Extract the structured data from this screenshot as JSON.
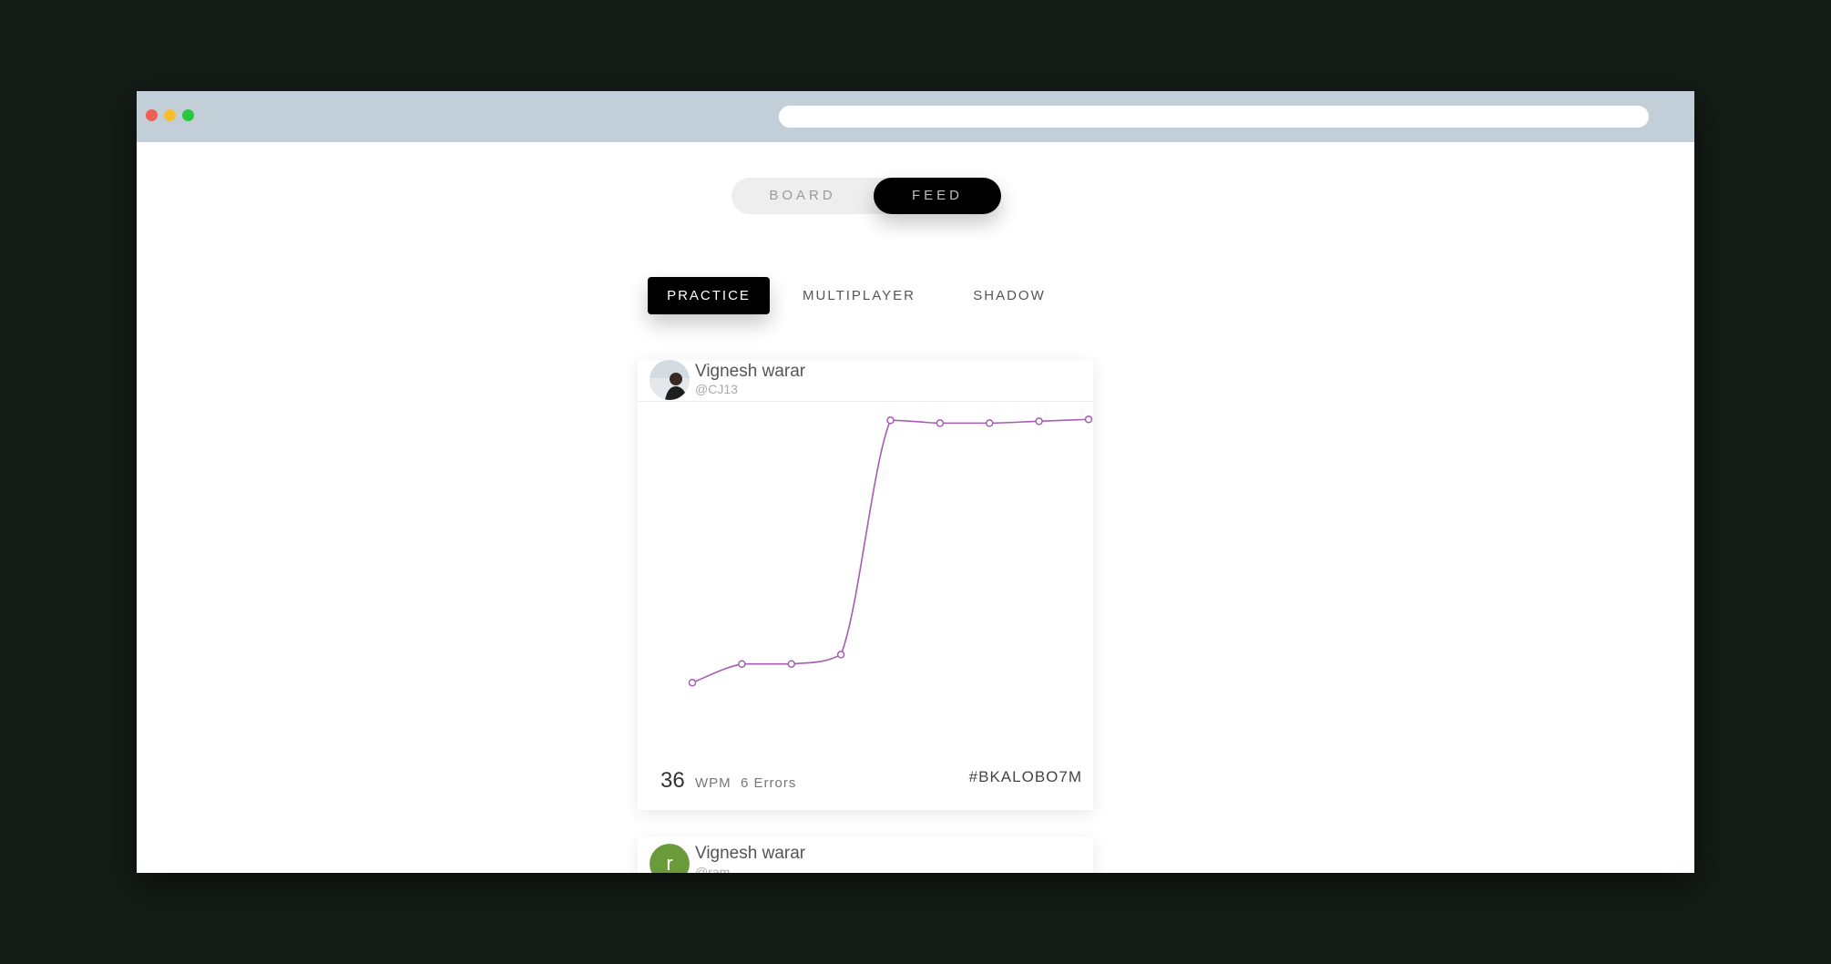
{
  "window": {
    "traffic_lights": [
      {
        "name": "close",
        "color": "#ef5f57"
      },
      {
        "name": "minimize",
        "color": "#f5bd2f"
      },
      {
        "name": "maximize",
        "color": "#29c740"
      }
    ],
    "url": ""
  },
  "view_toggle": {
    "board_label": "BOARD",
    "feed_label": "FEED",
    "active": "FEED"
  },
  "mode_tabs": {
    "items": [
      {
        "label": "PRACTICE",
        "active": true
      },
      {
        "label": "MULTIPLAYER",
        "active": false
      },
      {
        "label": "SHADOW",
        "active": false
      }
    ]
  },
  "feed": [
    {
      "user_name": "Vignesh warar",
      "handle": "@CJ13",
      "avatar_type": "photo",
      "wpm": "36",
      "wpm_unit": "WPM",
      "errors": "6 Errors",
      "code": "#BKALOBO7M",
      "line_color": "#a85bb5"
    },
    {
      "user_name": "Vignesh warar",
      "handle": "@ram",
      "avatar_type": "letter",
      "avatar_letter": "r",
      "avatar_color": "#6b9a3a"
    }
  ],
  "chart_data": {
    "type": "line",
    "x": [
      1,
      2,
      3,
      4,
      5,
      6,
      7,
      8,
      9
    ],
    "series": [
      {
        "values": [
          6,
          8,
          8,
          9,
          34,
          33.7,
          33.7,
          33.9,
          34.1
        ]
      }
    ],
    "ylim": [
      0,
      35
    ],
    "grid": false,
    "title": "",
    "xlabel": "",
    "ylabel": ""
  }
}
